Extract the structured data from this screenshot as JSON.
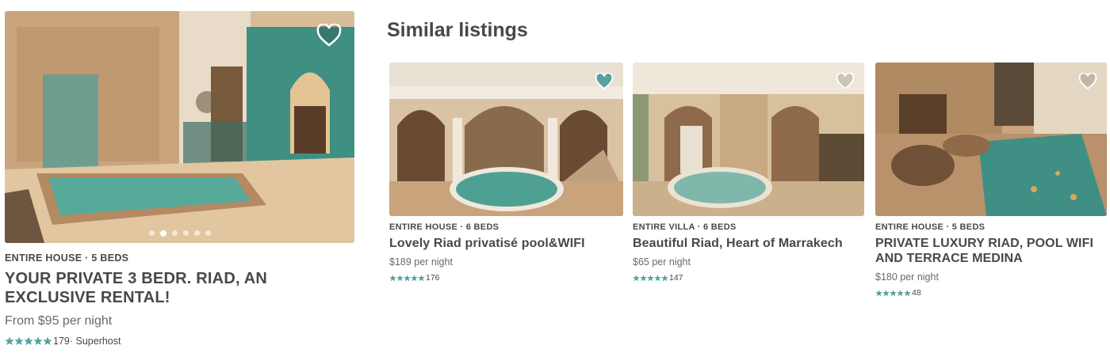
{
  "colors": {
    "accent_star": "#57a2a0",
    "text_primary": "#484848",
    "text_secondary": "#6a6a6a",
    "pool_teal": "#3a9e91",
    "wall_sand": "#c9a884"
  },
  "main_listing": {
    "kicker": "ENTIRE HOUSE · 5 BEDS",
    "title": "YOUR PRIVATE 3 BEDR. RIAD, AN EXCLUSIVE RENTAL!",
    "price": "From $95  per night",
    "rating_stars": 5,
    "review_count": "179",
    "badge": " · Superhost",
    "photo_icon": "heart-outline-icon",
    "carousel_dots": 6,
    "carousel_active": 1
  },
  "similar": {
    "title": "Similar listings",
    "items": [
      {
        "kicker": "ENTIRE HOUSE · 6 BEDS",
        "title": "Lovely Riad privatisé pool&WIFI",
        "price": "$189  per night",
        "rating_stars": 5,
        "review_count": "176",
        "heart": "heart-filled-icon"
      },
      {
        "kicker": "ENTIRE VILLA · 6 BEDS",
        "title": "Beautiful Riad, Heart of Marrakech",
        "price": "$65  per night",
        "rating_stars": 5,
        "review_count": "147",
        "heart": "heart-outline-icon"
      },
      {
        "kicker": "ENTIRE HOUSE · 5 BEDS",
        "title": "PRIVATE LUXURY RIAD, POOL WIFI AND TERRACE MEDINA",
        "price": "$180  per night",
        "rating_stars": 5,
        "review_count": "48",
        "heart": "heart-outline-icon"
      }
    ]
  }
}
